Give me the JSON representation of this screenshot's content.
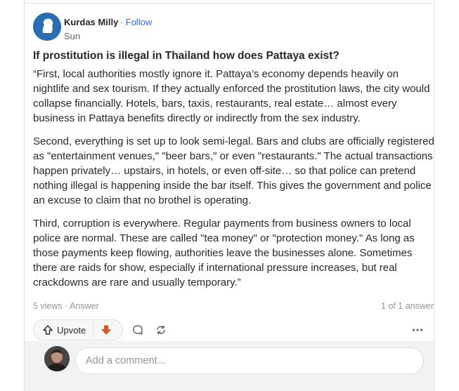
{
  "author": {
    "name": "Kurdas Milly",
    "separator": "·",
    "follow_label": "Follow",
    "date": "Sun"
  },
  "question": {
    "title": "If prostitution is illegal in Thailand how does Pattaya exist?"
  },
  "answer": {
    "paragraphs": [
      "“First, local authorities mostly ignore it. Pattaya’s economy depends heavily on nightlife and sex tourism. If they actually enforced the prostitution laws, the city would collapse financially. Hotels, bars, taxis, restaurants, real estate… almost every business in Pattaya benefits directly or indirectly from the sex industry.",
      "Second, everything is set up to look semi-legal. Bars and clubs are officially registered as \"entertainment venues,\" \"beer bars,\" or even \"restaurants.\" The actual transactions happen privately… upstairs, in hotels, or even off-site… so that police can pretend nothing illegal is happening inside the bar itself. This gives the government and police an excuse to claim that no brothel is operating.",
      "Third, corruption is everywhere. Regular payments from business owners to local police are normal. These are called \"tea money\" or \"protection money.\" As long as those payments keep flowing, authorities leave the businesses alone. Sometimes there are raids for show, especially if international pressure increases, but real crackdowns are rare and usually temporary.”"
    ]
  },
  "meta": {
    "views": "5 views · Answer",
    "answer_count": "1 of 1 answer"
  },
  "actions": {
    "upvote_label": "Upvote",
    "upvote_icon": "upvote-arrow-icon",
    "downvote_icon": "downvote-arrow-icon",
    "comment_icon": "comment-bubble-icon",
    "share_icon": "share-arrows-icon",
    "more_icon": "ellipsis-icon",
    "downvote_color": "#d9561f"
  },
  "comment_box": {
    "placeholder": "Add a comment..."
  },
  "colors": {
    "link": "#2e69ff",
    "text": "#282829",
    "muted": "#939598",
    "avatar_bg": "#2a6db3"
  }
}
